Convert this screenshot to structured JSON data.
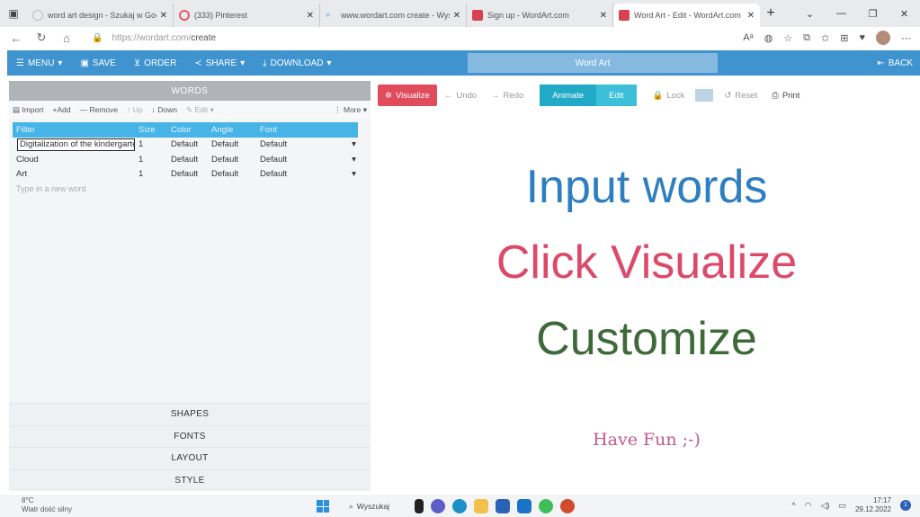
{
  "browser": {
    "tabs": [
      {
        "title": "word art design - Szukaj w Goo",
        "fav": "#e8e8e8"
      },
      {
        "title": "(333) Pinterest",
        "fav": "#e65a6a"
      },
      {
        "title": "www.wordart.com create - Wysz",
        "fav": "#4a8fe0"
      },
      {
        "title": "Sign up - WordArt.com",
        "fav": "#d94050"
      },
      {
        "title": "Word Art - Edit - WordArt.com",
        "fav": "#d94050"
      }
    ],
    "url_host": "https://wordart.com/",
    "url_path": "create"
  },
  "app": {
    "menu": "MENU",
    "save": "SAVE",
    "order": "ORDER",
    "share": "SHARE",
    "download": "DOWNLOAD",
    "title": "Word Art",
    "back": "BACK"
  },
  "words_panel": {
    "header": "WORDS",
    "toolbar": {
      "import": "Import",
      "add": "Add",
      "remove": "Remove",
      "up": "Up",
      "down": "Down",
      "edit": "Edit",
      "more": "More"
    },
    "columns": [
      "Filter",
      "Size",
      "Color",
      "Angle",
      "Font"
    ],
    "rows": [
      {
        "word": "Digitalization of the kindergarte",
        "size": "1",
        "color": "Default",
        "angle": "Default",
        "font": "Default"
      },
      {
        "word": "Cloud",
        "size": "1",
        "color": "Default",
        "angle": "Default",
        "font": "Default"
      },
      {
        "word": "Art",
        "size": "1",
        "color": "Default",
        "angle": "Default",
        "font": "Default"
      }
    ],
    "new_word_placeholder": "Type in a new word",
    "sections": [
      "SHAPES",
      "FONTS",
      "LAYOUT",
      "STYLE"
    ]
  },
  "canvas_toolbar": {
    "visualize": "Visualize",
    "undo": "Undo",
    "redo": "Redo",
    "animate": "Animate",
    "edit": "Edit",
    "lock": "Lock",
    "reset": "Reset",
    "print": "Print"
  },
  "canvas": {
    "line1": "Input words",
    "line2": "Click Visualize",
    "line3": "Customize",
    "line4": "Have Fun ;-)"
  },
  "taskbar": {
    "temp": "8°C",
    "weather": "Wiatr dość silny",
    "search": "Wyszukaj",
    "time": "17:17",
    "date": "29.12.2022"
  }
}
